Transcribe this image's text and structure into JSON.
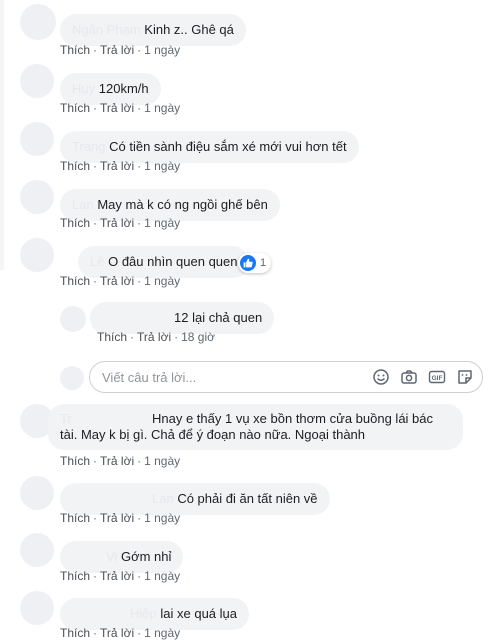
{
  "comments": [
    {
      "name": "Ngân Phạm",
      "text": "Kinh z.. Ghê qá",
      "actions": {
        "like": "Thích",
        "reply": "Trả lời",
        "time": "1 ngày"
      }
    },
    {
      "name": "Huy",
      "text": "120km/h",
      "actions": {
        "like": "Thích",
        "reply": "Trả lời",
        "time": "1 ngày"
      }
    },
    {
      "name": "Trang",
      "text": "Có tiền sành điệu sắm xé mới vui hơn tết",
      "actions": {
        "like": "Thích",
        "reply": "Trả lời",
        "time": "1 ngày"
      }
    },
    {
      "name": "Lan",
      "text": "May mà k có ng ngồi ghế bên",
      "actions": {
        "like": "Thích",
        "reply": "Trả lời",
        "time": "1 ngày"
      }
    },
    {
      "name": "Lê",
      "text": "O đâu nhìn quen quen",
      "reaction_count": "1",
      "actions": {
        "like": "Thích",
        "reply": "Trả lời",
        "time": "1 ngày"
      }
    }
  ],
  "reply": {
    "name": "",
    "text": "12 lại chả quen",
    "actions": {
      "like": "Thích",
      "reply": "Trả lời",
      "time": "18 giờ"
    }
  },
  "reply_box": {
    "placeholder": "Viết câu trả lời..."
  },
  "comments2": [
    {
      "name": "Tr",
      "line1": "Hnay e thấy 1 vụ xe bồn thơm cửa buồng lái bác",
      "line2": "tài. May k bị gì. Chả để ý đoạn nào nữa. Ngoại thành",
      "actions": {
        "like": "Thích",
        "reply": "Trả lời",
        "time": "1 ngày"
      }
    },
    {
      "name": "Lan",
      "text": "Có phải đi ăn tất niên về",
      "actions": {
        "like": "Thích",
        "reply": "Trả lời",
        "time": "1 ngày"
      }
    },
    {
      "name": "Vi",
      "text": "Gớm nhỉ",
      "actions": {
        "like": "Thích",
        "reply": "Trả lời",
        "time": "1 ngày"
      }
    },
    {
      "name": "Hiệp",
      "text": "lai xe quá lụa",
      "actions": {
        "like": "Thích",
        "reply": "Trả lời",
        "time": "1 ngày"
      }
    }
  ],
  "icons": [
    "smiley-icon",
    "camera-icon",
    "gif-icon",
    "sticker-icon",
    "like-icon"
  ],
  "colors": {
    "bubble": "#f2f3f5",
    "link": "#4b4f56",
    "meta": "#606770",
    "like_blue": "#1877f2",
    "input_border": "#ccd0d5"
  }
}
